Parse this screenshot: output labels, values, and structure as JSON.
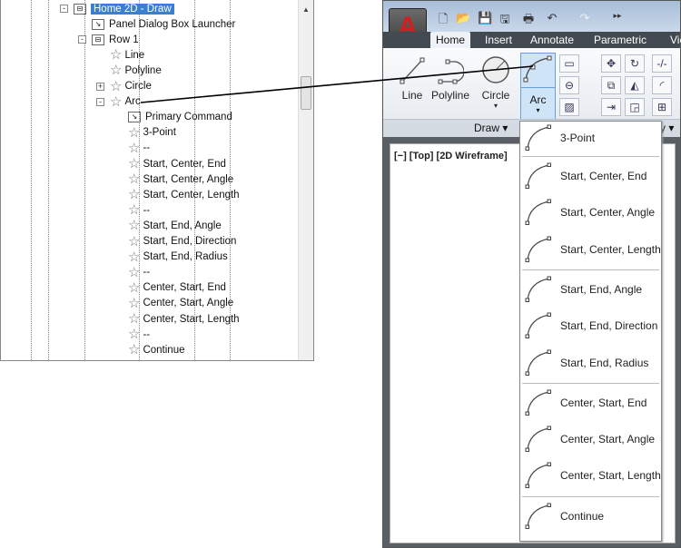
{
  "tree": {
    "items": [
      {
        "label": "Home 2D - Draw",
        "level": 0,
        "kind": "panel",
        "toggle": "-",
        "selected": true
      },
      {
        "label": "Panel Dialog Box Launcher",
        "level": 1,
        "kind": "launcher"
      },
      {
        "label": "Row 1",
        "level": 1,
        "kind": "panel",
        "toggle": "-"
      },
      {
        "label": "Line",
        "level": 2,
        "kind": "star"
      },
      {
        "label": "Polyline",
        "level": 2,
        "kind": "star"
      },
      {
        "label": "Circle",
        "level": 2,
        "kind": "star",
        "toggle": "+"
      },
      {
        "label": "Arc",
        "level": 2,
        "kind": "star",
        "toggle": "-"
      },
      {
        "label": "Primary Command",
        "level": 3,
        "kind": "launcher"
      },
      {
        "label": "3-Point",
        "level": 3,
        "kind": "star"
      },
      {
        "label": "--",
        "level": 3,
        "kind": "star"
      },
      {
        "label": "Start, Center, End",
        "level": 3,
        "kind": "star"
      },
      {
        "label": "Start, Center, Angle",
        "level": 3,
        "kind": "star"
      },
      {
        "label": "Start, Center, Length",
        "level": 3,
        "kind": "star"
      },
      {
        "label": "--",
        "level": 3,
        "kind": "star"
      },
      {
        "label": "Start, End, Angle",
        "level": 3,
        "kind": "star"
      },
      {
        "label": "Start, End, Direction",
        "level": 3,
        "kind": "star"
      },
      {
        "label": "Start, End, Radius",
        "level": 3,
        "kind": "star"
      },
      {
        "label": "--",
        "level": 3,
        "kind": "star"
      },
      {
        "label": "Center, Start, End",
        "level": 3,
        "kind": "star"
      },
      {
        "label": "Center, Start, Angle",
        "level": 3,
        "kind": "star"
      },
      {
        "label": "Center, Start, Length",
        "level": 3,
        "kind": "star"
      },
      {
        "label": "--",
        "level": 3,
        "kind": "star"
      },
      {
        "label": "Continue",
        "level": 3,
        "kind": "star"
      }
    ]
  },
  "app": {
    "logo_letter": "A",
    "tabs": [
      "Home",
      "Insert",
      "Annotate",
      "Parametric",
      "Vie"
    ],
    "active_tab": "Home",
    "draw_buttons": [
      "Line",
      "Polyline",
      "Circle",
      "Arc"
    ],
    "panel_label": "Draw ▾",
    "modify_label_partial": "y ▾",
    "viewport_label": "[−] [Top] [2D Wireframe]"
  },
  "dropdown": {
    "groups": [
      [
        "3-Point"
      ],
      [
        "Start, Center, End",
        "Start, Center, Angle",
        "Start, Center, Length"
      ],
      [
        "Start, End, Angle",
        "Start, End, Direction",
        "Start, End, Radius"
      ],
      [
        "Center, Start, End",
        "Center, Start, Angle",
        "Center, Start, Length"
      ],
      [
        "Continue"
      ]
    ]
  },
  "colors": {
    "selection": "#3a7fd0",
    "arc_button": "#cfe4f6",
    "logo_red": "#d21f1f"
  }
}
